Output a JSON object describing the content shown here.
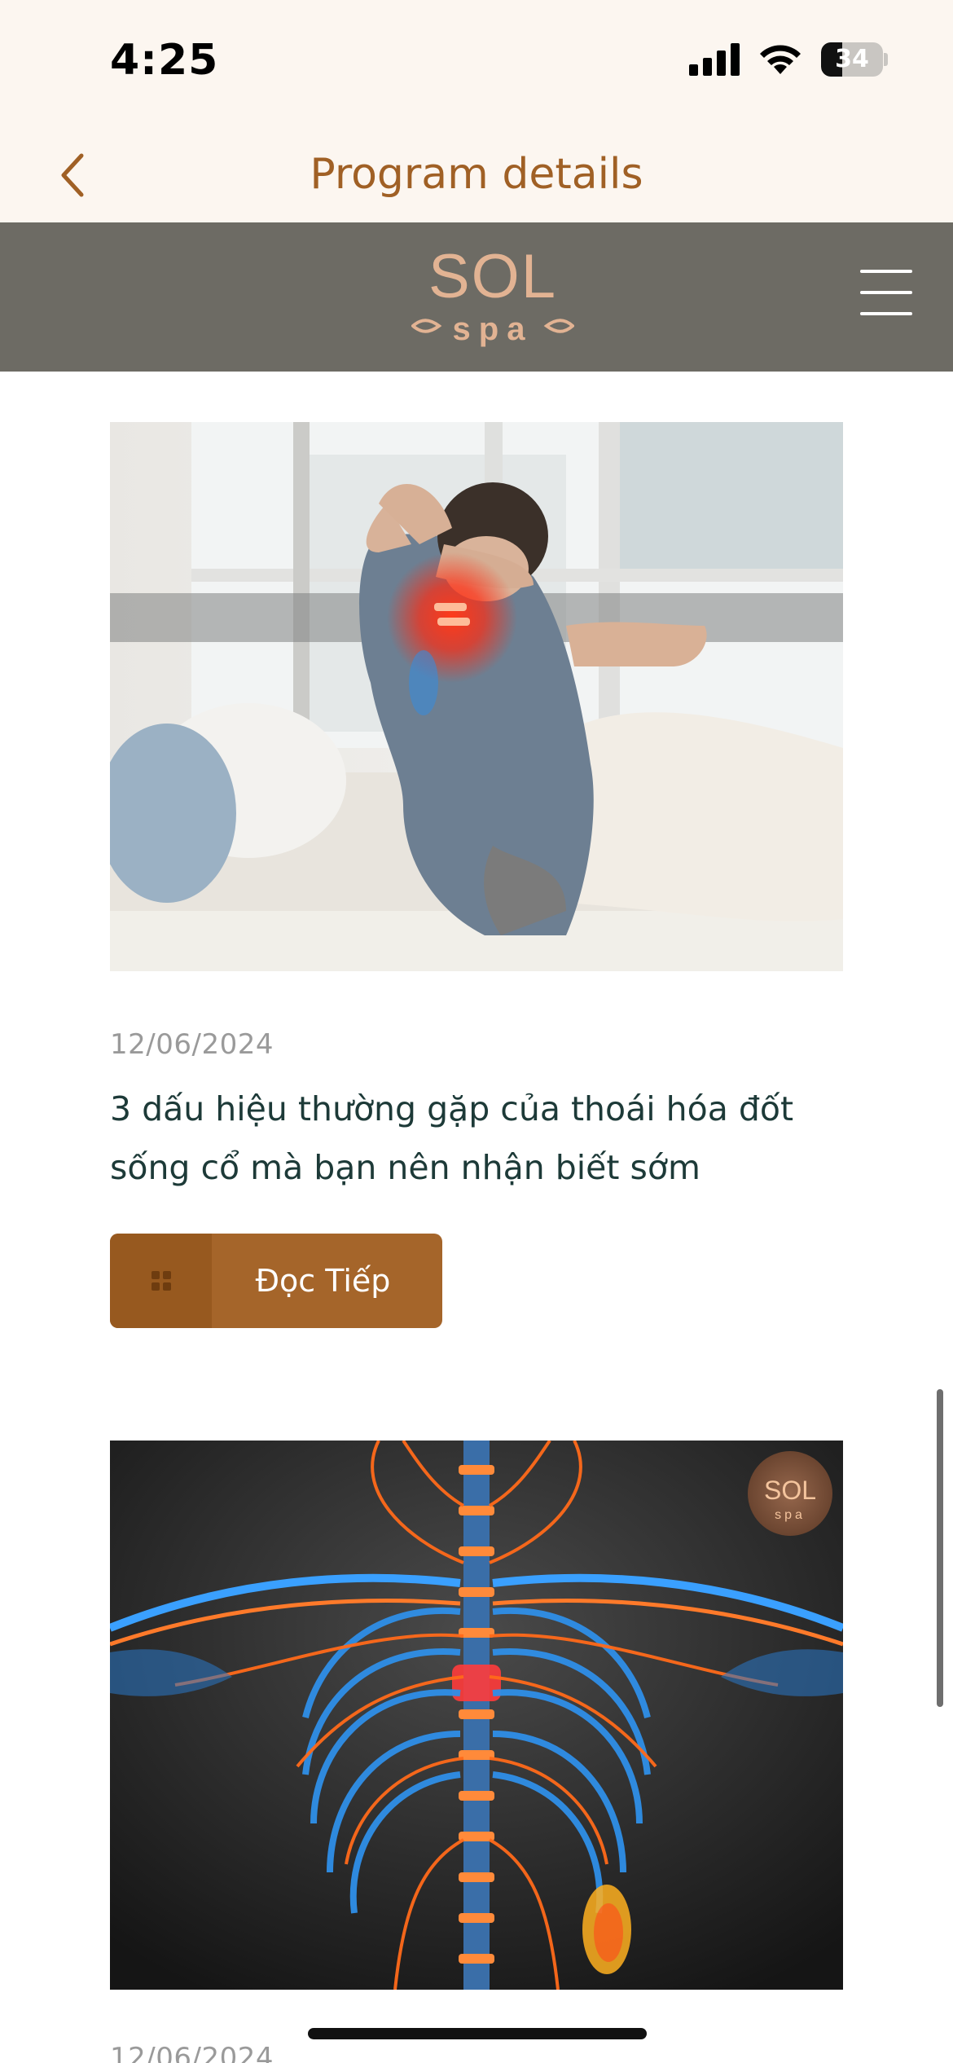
{
  "status_bar": {
    "time": "4:25",
    "battery_level": "34",
    "icons": [
      "cellular-signal-icon",
      "wifi-icon",
      "battery-icon"
    ]
  },
  "nav": {
    "title": "Program details",
    "back_icon": "chevron-left-icon"
  },
  "site_header": {
    "logo_text": "SOL",
    "logo_sub": "spa",
    "menu_icon": "hamburger-menu-icon"
  },
  "posts": [
    {
      "image": "man-with-neck-pain-in-bed",
      "date": "12/06/2024",
      "title": "3 dấu hiệu thường gặp của thoái hóa đốt sống cổ mà bạn nên nhận biết sớm",
      "button_label": "Đọc Tiếp",
      "button_icon": "grid-icon"
    },
    {
      "image": "spine-nervous-system-illustration",
      "date": "12/06/2024"
    }
  ],
  "colors": {
    "accent": "#a5652a",
    "header_bg": "#fcf6f0",
    "site_bar_bg": "#6d6b64",
    "title_text": "#1d3a38"
  }
}
